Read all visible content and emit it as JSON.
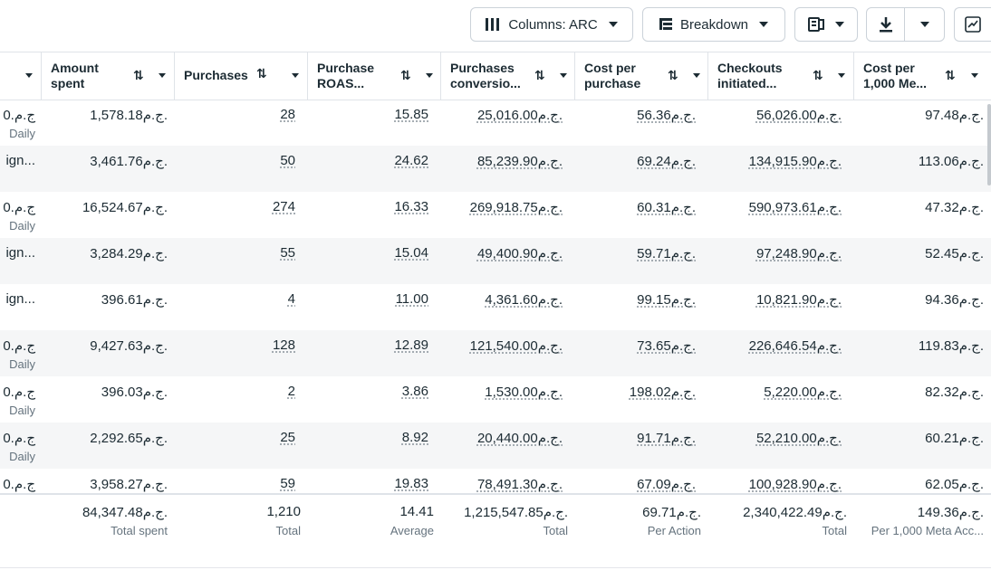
{
  "toolbar": {
    "columns_label": "Columns: ARC",
    "breakdown_label": "Breakdown"
  },
  "headers": [
    {
      "line1": "",
      "line2": ""
    },
    {
      "line1": "Amount",
      "line2": "spent"
    },
    {
      "line1": "Purchases",
      "line2": ""
    },
    {
      "line1": "Purchase",
      "line2": "ROAS..."
    },
    {
      "line1": "Purchases",
      "line2": "conversio..."
    },
    {
      "line1": "Cost per",
      "line2": "purchase"
    },
    {
      "line1": "Checkouts",
      "line2": "initiated..."
    },
    {
      "line1": "Cost per",
      "line2": "1,000 Me..."
    }
  ],
  "sort_glyph": "⇅",
  "rows": [
    {
      "c0": "0.ج.م",
      "c0_sub": "Daily",
      "spent": "1,578.18ج.م.",
      "purchases": "28",
      "roas": "15.85",
      "conv": "25,016.00ج.م.",
      "cpp": "56.36ج.م.",
      "checkouts": "56,026.00ج.م.",
      "cpm": "97.48ج.م."
    },
    {
      "c0": "ign...",
      "c0_sub": "",
      "spent": "3,461.76ج.م.",
      "purchases": "50",
      "roas": "24.62",
      "conv": "85,239.90ج.م.",
      "cpp": "69.24ج.م.",
      "checkouts": "134,915.90ج.م.",
      "cpm": "113.06ج.م."
    },
    {
      "c0": "0.ج.م",
      "c0_sub": "Daily",
      "spent": "16,524.67ج.م.",
      "purchases": "274",
      "roas": "16.33",
      "conv": "269,918.75ج.م.",
      "cpp": "60.31ج.م.",
      "checkouts": "590,973.61ج.م.",
      "cpm": "47.32ج.م."
    },
    {
      "c0": "ign...",
      "c0_sub": "",
      "spent": "3,284.29ج.م.",
      "purchases": "55",
      "roas": "15.04",
      "conv": "49,400.90ج.م.",
      "cpp": "59.71ج.م.",
      "checkouts": "97,248.90ج.م.",
      "cpm": "52.45ج.م."
    },
    {
      "c0": "ign...",
      "c0_sub": "",
      "spent": "396.61ج.م.",
      "purchases": "4",
      "roas": "11.00",
      "conv": "4,361.60ج.م.",
      "cpp": "99.15ج.م.",
      "checkouts": "10,821.90ج.م.",
      "cpm": "94.36ج.م."
    },
    {
      "c0": "0.ج.م",
      "c0_sub": "Daily",
      "spent": "9,427.63ج.م.",
      "purchases": "128",
      "roas": "12.89",
      "conv": "121,540.00ج.م.",
      "cpp": "73.65ج.م.",
      "checkouts": "226,646.54ج.م.",
      "cpm": "119.83ج.م."
    },
    {
      "c0": "0.ج.م",
      "c0_sub": "Daily",
      "spent": "396.03ج.م.",
      "purchases": "2",
      "roas": "3.86",
      "conv": "1,530.00ج.م.",
      "cpp": "198.02ج.م.",
      "checkouts": "5,220.00ج.م.",
      "cpm": "82.32ج.م."
    },
    {
      "c0": "0.ج.م",
      "c0_sub": "Daily",
      "spent": "2,292.65ج.م.",
      "purchases": "25",
      "roas": "8.92",
      "conv": "20,440.00ج.م.",
      "cpp": "91.71ج.م.",
      "checkouts": "52,210.00ج.م.",
      "cpm": "60.21ج.م."
    },
    {
      "c0": "0.ج.م",
      "c0_sub": "",
      "spent": "3,958.27ج.م.",
      "purchases": "59",
      "roas": "19.83",
      "conv": "78,491.30ج.م.",
      "cpp": "67.09ج.م.",
      "checkouts": "100,928.90ج.م.",
      "cpm": "62.05ج.م."
    }
  ],
  "totals": {
    "spent": "84,347.48ج.م.",
    "spent_sub": "Total spent",
    "purchases": "1,210",
    "purchases_sub": "Total",
    "roas": "14.41",
    "roas_sub": "Average",
    "conv": "1,215,547.85ج.م.",
    "conv_sub": "Total",
    "cpp": "69.71ج.م.",
    "cpp_sub": "Per Action",
    "checkouts": "2,340,422.49ج.م.",
    "checkouts_sub": "Total",
    "cpm": "149.36ج.م.",
    "cpm_sub": "Per 1,000 Meta Acc..."
  }
}
